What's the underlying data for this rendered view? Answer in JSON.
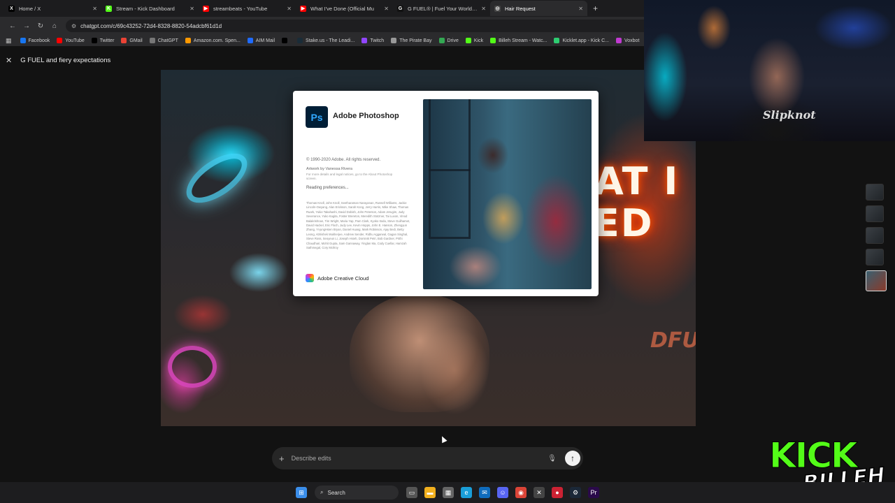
{
  "browser": {
    "tabs": [
      {
        "label": "Home / X",
        "icon": "x-icon",
        "icon_color": "#000000",
        "glyph": "X"
      },
      {
        "label": "Stream - Kick Dashboard",
        "icon": "kick-icon",
        "icon_color": "#53fc18",
        "glyph": "K"
      },
      {
        "label": "streambeats - YouTube",
        "icon": "youtube-icon",
        "icon_color": "#ff0000",
        "glyph": "▶"
      },
      {
        "label": "What I've Done (Official Mu",
        "icon": "youtube-icon",
        "icon_color": "#ff0000",
        "glyph": "▶"
      },
      {
        "label": "G FUEL® | Fuel Your Worlds wi",
        "icon": "gfuel-icon",
        "icon_color": "#111111",
        "glyph": "G"
      },
      {
        "label": "Hair Request",
        "icon": "chatgpt-icon",
        "icon_color": "#444444",
        "glyph": "◎"
      }
    ],
    "active_tab": 5,
    "url": "chatgpt.com/c/69c43252-72d4-8328-8820-54adcbf61d1d",
    "bookmarks": [
      {
        "label": "Facebook",
        "color": "#1877f2"
      },
      {
        "label": "YouTube",
        "color": "#ff0000"
      },
      {
        "label": "Twitter",
        "color": "#000000"
      },
      {
        "label": "GMail",
        "color": "#ea4335"
      },
      {
        "label": "ChatGPT",
        "color": "#777777"
      },
      {
        "label": "Amazon.com. Spen...",
        "color": "#ff9900"
      },
      {
        "label": "AIM Mail",
        "color": "#1f6bff"
      },
      {
        "label": "",
        "color": "#000000"
      },
      {
        "label": "Stake.us - The Leadi...",
        "color": "#1a2c38"
      },
      {
        "label": "Twitch",
        "color": "#9146ff"
      },
      {
        "label": "The Pirate Bay",
        "color": "#999999"
      },
      {
        "label": "Drive",
        "color": "#34a853"
      },
      {
        "label": "Kick",
        "color": "#53fc18"
      },
      {
        "label": "Billeh Stream - Watc...",
        "color": "#53fc18"
      },
      {
        "label": "Kicklet.app - Kick C...",
        "color": "#2ecc71"
      },
      {
        "label": "Voxbot",
        "color": "#c03ad0"
      }
    ]
  },
  "page": {
    "title": "G FUEL and fiery expectations",
    "prompt_placeholder": "Describe edits"
  },
  "image": {
    "overlay_text": "AT I\nTED",
    "overlay_text2": "DFUL"
  },
  "splash": {
    "app_name": "Adobe Photoshop",
    "logo": "Ps",
    "copyright": "© 1990-2020 Adobe. All rights reserved.",
    "artwork": "Artwork by Vanessa Rivera",
    "legal": "For more details and legal notices, go to the About Photoshop screen.",
    "status": "Reading preferences...",
    "credits": "Thomas Knoll, John Knoll, Seetharaman Narayanan, Russell Williams, Jackie Lincoln-Owyang, Alan Erickson, Sarah Kong, Jerry Harris, Mike Shaw, Thomas Ruark, Yukie Takahashi, David Dobish, John Peterson, Adam Jerugim, Judy Severance, Yuko Kagita, Foster Brereton, Meredith Stotzner, Tai Luxon, Vinod Balakrishnan, Tim Wright, Maria Yap, Pam Clark, Kyoko Itoda, Steve Guilhamet, David Hackel, Eric Floch, Judy Lee, Kevin Hopps, John E. Hanson, Zhengyun Zhang, Yi-jungHsien Bryan, Daniel Huang, Mark Robinson, Ajay Bedi, Betty Leong, Abhishek Mukherjee, Andrew Sender, Ridhu Aggarwal, Gagan Singhal, Steve Ross, Seoyeun Li, Joseph Hsieh, Dominik Petri, Bob Gardner, Prithi Chaudhari, Mohit Gupta, Sam Gannaway, Yinglan Ma, Cody Cuellar, Hamzah Sathmegal, Cory McIlroy",
    "cc_label": "Adobe Creative Cloud"
  },
  "webcam": {
    "shirt_text": "Slipknot"
  },
  "overlay": {
    "kick_word": "KICK",
    "channel_word": "BILLEH"
  },
  "taskbar": {
    "search_label": "Search",
    "apps": [
      {
        "name": "start-icon",
        "color": "#3b8eea",
        "glyph": "⊞"
      },
      {
        "name": "task-view-icon",
        "color": "#555555",
        "glyph": "▭"
      },
      {
        "name": "file-explorer-icon",
        "color": "#f2b01e",
        "glyph": "▬"
      },
      {
        "name": "store-icon",
        "color": "#666666",
        "glyph": "▦"
      },
      {
        "name": "edge-icon",
        "color": "#1a9ed8",
        "glyph": "e"
      },
      {
        "name": "outlook-icon",
        "color": "#0f6cbd",
        "glyph": "✉"
      },
      {
        "name": "discord-icon",
        "color": "#5865f2",
        "glyph": "☺"
      },
      {
        "name": "chrome-icon",
        "color": "#db4437",
        "glyph": "◉"
      },
      {
        "name": "xbox-icon",
        "color": "#444444",
        "glyph": "✕"
      },
      {
        "name": "obs-icon",
        "color": "#cc2233",
        "glyph": "●"
      },
      {
        "name": "steam-icon",
        "color": "#1b2838",
        "glyph": "⚙"
      },
      {
        "name": "premiere-icon",
        "color": "#2a0a4a",
        "glyph": "Pr"
      }
    ]
  }
}
